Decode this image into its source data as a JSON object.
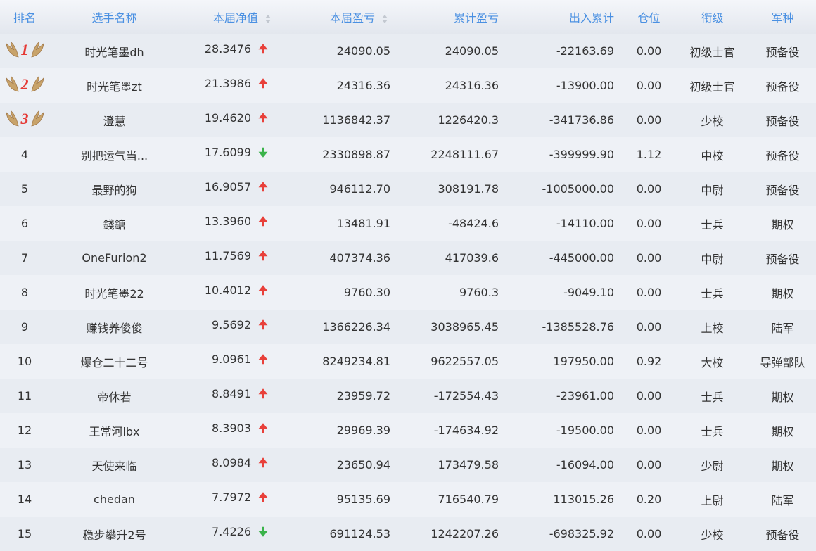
{
  "headers": {
    "rank": "排名",
    "name": "选手名称",
    "nav": "本届净值",
    "pnl": "本届盈亏",
    "cum_pnl": "累计盈亏",
    "flow": "出入累计",
    "position": "仓位",
    "title": "衔级",
    "branch": "军种"
  },
  "colors": {
    "up": "#e8403a",
    "down": "#3ab34a",
    "header_text": "#4a90e2",
    "medal_num": "#e53935",
    "wing": "#c8a36a"
  },
  "rows": [
    {
      "rank": "1",
      "medal": true,
      "name": "时光笔墨dh",
      "nav": "28.3476",
      "dir": "up",
      "arrow": "🠉",
      "pnl": "24090.05",
      "cum_pnl": "24090.05",
      "flow": "-22163.69",
      "position": "0.00",
      "title": "初级士官",
      "branch": "预备役"
    },
    {
      "rank": "2",
      "medal": true,
      "name": "时光笔墨zt",
      "nav": "21.3986",
      "dir": "up",
      "arrow": "🠉",
      "pnl": "24316.36",
      "cum_pnl": "24316.36",
      "flow": "-13900.00",
      "position": "0.00",
      "title": "初级士官",
      "branch": "预备役"
    },
    {
      "rank": "3",
      "medal": true,
      "name": "澄慧",
      "nav": "19.4620",
      "dir": "up",
      "arrow": "🠉",
      "pnl": "1136842.37",
      "cum_pnl": "1226420.3",
      "flow": "-341736.86",
      "position": "0.00",
      "title": "少校",
      "branch": "预备役"
    },
    {
      "rank": "4",
      "medal": false,
      "name": "别把运气当...",
      "nav": "17.6099",
      "dir": "down",
      "arrow": "🠋",
      "pnl": "2330898.87",
      "cum_pnl": "2248111.67",
      "flow": "-399999.90",
      "position": "1.12",
      "title": "中校",
      "branch": "预备役"
    },
    {
      "rank": "5",
      "medal": false,
      "name": "最野的狗",
      "nav": "16.9057",
      "dir": "up",
      "arrow": "🠉",
      "pnl": "946112.70",
      "cum_pnl": "308191.78",
      "flow": "-1005000.00",
      "position": "0.00",
      "title": "中尉",
      "branch": "预备役"
    },
    {
      "rank": "6",
      "medal": false,
      "name": "錢鎕",
      "nav": "13.3960",
      "dir": "up",
      "arrow": "🠉",
      "pnl": "13481.91",
      "cum_pnl": "-48424.6",
      "flow": "-14110.00",
      "position": "0.00",
      "title": "士兵",
      "branch": "期权"
    },
    {
      "rank": "7",
      "medal": false,
      "name": "OneFurion2",
      "nav": "11.7569",
      "dir": "up",
      "arrow": "🠉",
      "pnl": "407374.36",
      "cum_pnl": "417039.6",
      "flow": "-445000.00",
      "position": "0.00",
      "title": "中尉",
      "branch": "预备役"
    },
    {
      "rank": "8",
      "medal": false,
      "name": "时光笔墨22",
      "nav": "10.4012",
      "dir": "up",
      "arrow": "🠉",
      "pnl": "9760.30",
      "cum_pnl": "9760.3",
      "flow": "-9049.10",
      "position": "0.00",
      "title": "士兵",
      "branch": "期权"
    },
    {
      "rank": "9",
      "medal": false,
      "name": "赚钱养俊俊",
      "nav": "9.5692",
      "dir": "up",
      "arrow": "🠉",
      "pnl": "1366226.34",
      "cum_pnl": "3038965.45",
      "flow": "-1385528.76",
      "position": "0.00",
      "title": "上校",
      "branch": "陆军"
    },
    {
      "rank": "10",
      "medal": false,
      "name": "爆仓二十二号",
      "nav": "9.0961",
      "dir": "up",
      "arrow": "🠉",
      "pnl": "8249234.81",
      "cum_pnl": "9622557.05",
      "flow": "197950.00",
      "position": "0.92",
      "title": "大校",
      "branch": "导弹部队"
    },
    {
      "rank": "11",
      "medal": false,
      "name": "帝休若",
      "nav": "8.8491",
      "dir": "up",
      "arrow": "🠉",
      "pnl": "23959.72",
      "cum_pnl": "-172554.43",
      "flow": "-23961.00",
      "position": "0.00",
      "title": "士兵",
      "branch": "期权"
    },
    {
      "rank": "12",
      "medal": false,
      "name": "王常河lbx",
      "nav": "8.3903",
      "dir": "up",
      "arrow": "🠉",
      "pnl": "29969.39",
      "cum_pnl": "-174634.92",
      "flow": "-19500.00",
      "position": "0.00",
      "title": "士兵",
      "branch": "期权"
    },
    {
      "rank": "13",
      "medal": false,
      "name": "天使来临",
      "nav": "8.0984",
      "dir": "up",
      "arrow": "🠉",
      "pnl": "23650.94",
      "cum_pnl": "173479.58",
      "flow": "-16094.00",
      "position": "0.00",
      "title": "少尉",
      "branch": "期权"
    },
    {
      "rank": "14",
      "medal": false,
      "name": "chedan",
      "nav": "7.7972",
      "dir": "up",
      "arrow": "🠉",
      "pnl": "95135.69",
      "cum_pnl": "716540.79",
      "flow": "113015.26",
      "position": "0.20",
      "title": "上尉",
      "branch": "陆军"
    },
    {
      "rank": "15",
      "medal": false,
      "name": "稳步攀升2号",
      "nav": "7.4226",
      "dir": "down",
      "arrow": "🠋",
      "pnl": "691124.53",
      "cum_pnl": "1242207.26",
      "flow": "-698325.92",
      "position": "0.00",
      "title": "少校",
      "branch": "预备役"
    }
  ]
}
